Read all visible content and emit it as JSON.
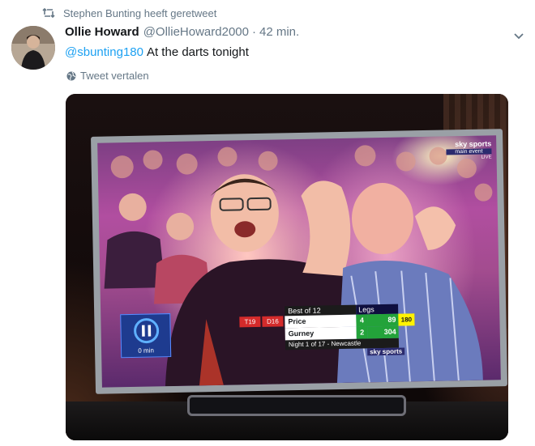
{
  "retweet_context": {
    "text": "Stephen Bunting heeft geretweet"
  },
  "tweet": {
    "author_name": "Ollie Howard",
    "author_handle": "@OllieHoward2000",
    "separator": "·",
    "timestamp": "42 min.",
    "mention": "@sbunting180",
    "text": "At the darts tonight",
    "translate_label": "Tweet vertalen"
  },
  "media": {
    "broadcaster": "sky sports",
    "channel": "main event",
    "live_label": "LIVE",
    "clock_label": "0 min",
    "scoreboard": {
      "format": "Best of 12",
      "legs_header": "Legs",
      "players": [
        {
          "name": "Price",
          "legs": "4",
          "score": "89",
          "checkout": "180"
        },
        {
          "name": "Gurney",
          "legs": "2",
          "score": "304"
        }
      ],
      "throws": [
        "T19",
        "D16"
      ],
      "footer": "Night 1 of 17 - Newcastle"
    },
    "watermark": "sky sports"
  },
  "colors": {
    "link": "#1da1f2",
    "secondary": "#657786",
    "text": "#14171a"
  }
}
